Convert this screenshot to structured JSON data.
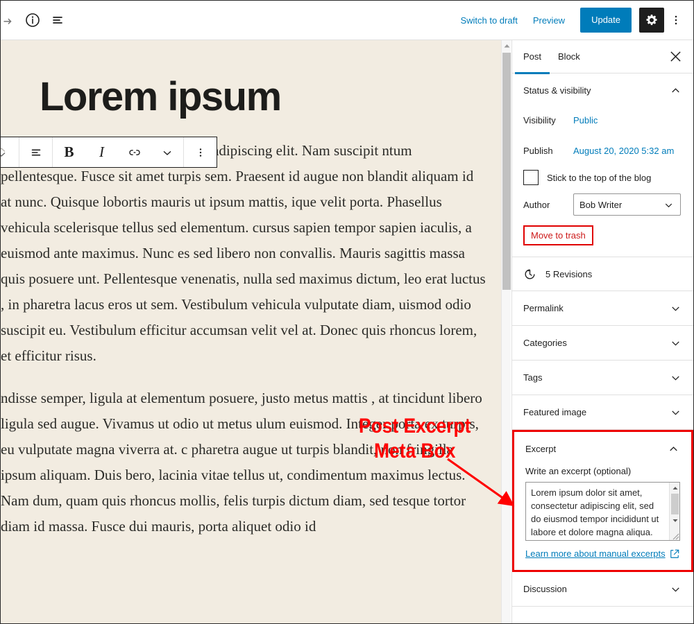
{
  "topbar": {
    "icons": {
      "redo": "redo-arrow-icon",
      "info": "info-icon",
      "list_view": "list-view-icon",
      "gear": "settings-gear-icon",
      "more": "more-options-icon"
    },
    "switch_to_draft_label": "Switch to draft",
    "preview_label": "Preview",
    "update_label": "Update",
    "accent_color": "#007cba",
    "gear_active_color": "#1e1e1e"
  },
  "editor": {
    "background_color": "#f2ece1",
    "title": "Lorem ipsum",
    "paragraphs": [
      "m ipsum dolor sit amet, consectetur adipiscing elit. Nam suscipit ntum pellentesque. Fusce sit amet turpis sem. Praesent id augue non  blandit aliquam id at nunc. Quisque lobortis mauris ut ipsum mattis, ique velit porta. Phasellus vehicula scelerisque tellus sed elementum.  cursus sapien tempor sapien iaculis, a euismod ante maximus. Nunc es sed libero non convallis. Mauris sagittis massa quis posuere unt. Pellentesque venenatis, nulla sed maximus dictum, leo erat luctus , in pharetra lacus eros ut sem. Vestibulum vehicula vulputate diam, uismod odio suscipit eu. Vestibulum efficitur accumsan velit vel at. Donec quis rhoncus lorem, et efficitur risus.",
      "ndisse semper, ligula at elementum posuere, justo metus mattis , at tincidunt libero ligula sed augue. Vivamus ut odio ut metus ulum euismod. Integer porta ex turpis, eu vulputate magna viverra at. c pharetra augue ut turpis blandit, non fringilla ipsum aliquam. Duis bero, lacinia vitae tellus ut, condimentum maximus lectus. Nam dum, quam quis rhoncus mollis, felis turpis dictum diam, sed tesque tortor diam id massa. Fusce dui mauris, porta aliquet odio id"
    ]
  },
  "block_toolbar": {
    "movers": "block-movers-icon",
    "paragraph_type": "paragraph-block-icon",
    "bold_label": "B",
    "italic_label": "I",
    "link": "link-icon",
    "more_formats": "chevron-down-icon",
    "options": "more-options-icon"
  },
  "sidebar": {
    "tabs": [
      {
        "label": "Post",
        "active": true
      },
      {
        "label": "Block",
        "active": false
      }
    ],
    "close_label": "Close settings",
    "status_panel": {
      "title": "Status & visibility",
      "visibility_label": "Visibility",
      "visibility_value": "Public",
      "publish_label": "Publish",
      "publish_value": "August 20, 2020 5:32 am",
      "sticky_label": "Stick to the top of the blog",
      "sticky_checked": false,
      "author_label": "Author",
      "author_value": "Bob Writer",
      "trash_label": "Move to trash"
    },
    "revisions_label": "5 Revisions",
    "panels": [
      {
        "title": "Permalink",
        "expanded": false
      },
      {
        "title": "Categories",
        "expanded": false
      },
      {
        "title": "Tags",
        "expanded": false
      },
      {
        "title": "Featured image",
        "expanded": false
      }
    ],
    "excerpt_panel": {
      "title": "Excerpt",
      "field_label": "Write an excerpt (optional)",
      "textarea_value": "Lorem ipsum dolor sit amet, consectetur adipiscing elit, sed do eiusmod tempor incididunt ut labore et dolore magna aliqua. Et",
      "textarea_placeholder": "Write an excerpt (optional)",
      "learn_more_label": "Learn more about manual excerpts",
      "highlight_color": "#ee0000"
    },
    "discussion_panel": {
      "title": "Discussion",
      "expanded": false
    }
  },
  "annotation": {
    "line1": "Post Excerpt",
    "line2": "Meta Box",
    "color": "#ff0000"
  }
}
